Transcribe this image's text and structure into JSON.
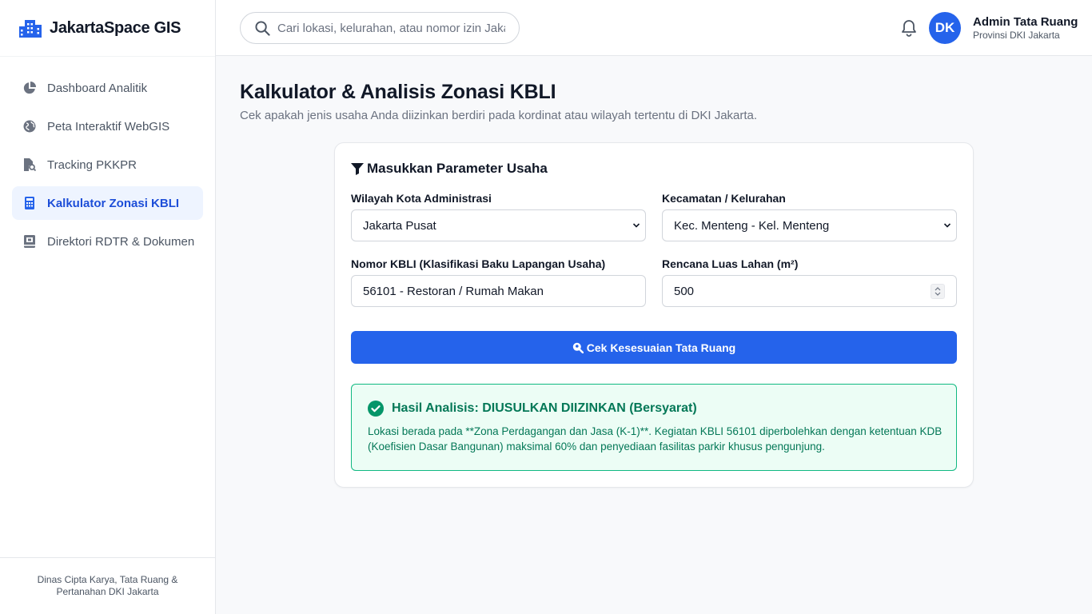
{
  "app": {
    "name": "JakartaSpace GIS"
  },
  "sidebar": {
    "items": [
      {
        "label": "Dashboard Analitik",
        "icon": "pie-chart-icon",
        "active": false
      },
      {
        "label": "Peta Interaktif WebGIS",
        "icon": "globe-icon",
        "active": false
      },
      {
        "label": "Tracking PKKPR",
        "icon": "file-search-icon",
        "active": false
      },
      {
        "label": "Kalkulator Zonasi KBLI",
        "icon": "calculator-icon",
        "active": true
      },
      {
        "label": "Direktori RDTR & Dokumen",
        "icon": "book-icon",
        "active": false
      }
    ],
    "footer": "Dinas Cipta Karya, Tata Ruang & Pertanahan DKI Jakarta"
  },
  "search": {
    "placeholder": "Cari lokasi, kelurahan, atau nomor izin Jakarta..."
  },
  "user": {
    "initials": "DK",
    "name": "Admin Tata Ruang",
    "role": "Provinsi DKI Jakarta"
  },
  "page": {
    "title": "Kalkulator & Analisis Zonasi KBLI",
    "subtitle": "Cek apakah jenis usaha Anda diizinkan berdiri pada kordinat atau wilayah tertentu di DKI Jakarta."
  },
  "form": {
    "title": "Masukkan Parameter Usaha",
    "city": {
      "label": "Wilayah Kota Administrasi",
      "value": "Jakarta Pusat"
    },
    "district": {
      "label": "Kecamatan / Kelurahan",
      "value": "Kec. Menteng - Kel. Menteng"
    },
    "kbli": {
      "label": "Nomor KBLI (Klasifikasi Baku Lapangan Usaha)",
      "value": "56101 - Restoran / Rumah Makan"
    },
    "area": {
      "label": "Rencana Luas Lahan (m²)",
      "value": "500"
    },
    "submit_label": "Cek Kesesuaian Tata Ruang"
  },
  "result": {
    "title": "Hasil Analisis: DIUSULKAN DIIZINKAN (Bersyarat)",
    "body": "Lokasi berada pada **Zona Perdagangan dan Jasa (K-1)**. Kegiatan KBLI 56101 diperbolehkan dengan ketentuan KDB (Koefisien Dasar Bangunan) maksimal 60% dan penyediaan fasilitas parkir khusus pengunjung."
  },
  "colors": {
    "primary": "#2563eb",
    "success": "#047857",
    "success_bg": "#ecfdf5"
  }
}
